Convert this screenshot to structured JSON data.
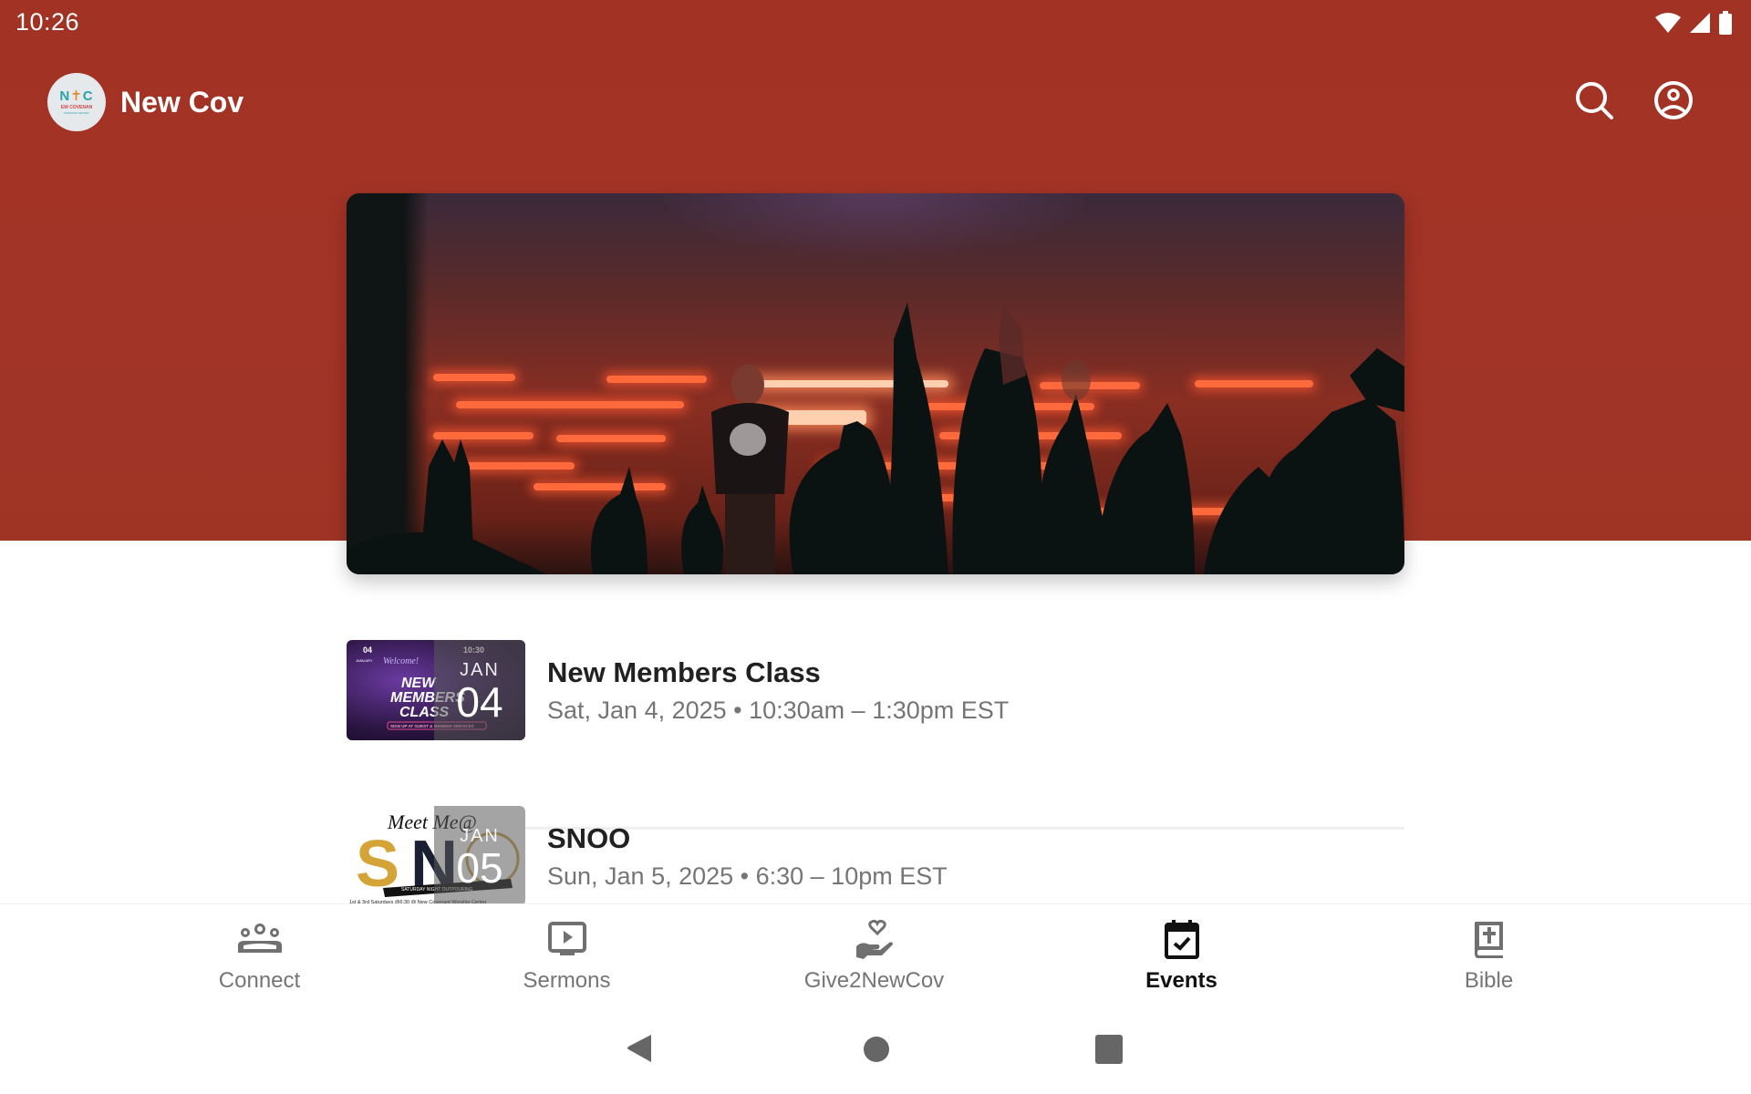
{
  "status_bar": {
    "time": "10:26",
    "icons": [
      "wifi-icon",
      "cellular-signal-icon",
      "battery-icon"
    ]
  },
  "app_bar": {
    "logo": {
      "mark": "NTC",
      "line1": "EW COVENAN",
      "line2": "WORSHIP CENTER"
    },
    "title": "New Cov",
    "actions": [
      "search-icon",
      "account-icon"
    ]
  },
  "hero": {
    "description": "Worship concert stage with red light bars and raised hands"
  },
  "events": [
    {
      "title": "New Members Class",
      "datetime": "Sat, Jan 4, 2025 • 10:30am – 1:30pm EST",
      "badge_month": "JAN",
      "badge_day": "04",
      "thumb_texts": [
        "04",
        "JANUARY",
        "Welcome!",
        "NEW MEMBERS CLASS",
        "10:30",
        "SIGN UP AT GUEST & MEMBER SERVICES"
      ]
    },
    {
      "title": "SNOO",
      "datetime": "Sun, Jan 5, 2025 • 6:30 – 10pm EST",
      "badge_month": "JAN",
      "badge_day": "05",
      "thumb_texts": [
        "Meet Me @",
        "SNO",
        "SATURDAY NIGHT OUTPOURING",
        "1st & 3rd Saturdays @6:30 @ New Covenant Worship Center"
      ]
    }
  ],
  "bottom_nav": {
    "items": [
      {
        "label": "Connect",
        "icon": "groups-icon",
        "active": false
      },
      {
        "label": "Sermons",
        "icon": "video-play-icon",
        "active": false
      },
      {
        "label": "Give2NewCov",
        "icon": "give-heart-hand-icon",
        "active": false
      },
      {
        "label": "Events",
        "icon": "calendar-check-icon",
        "active": true
      },
      {
        "label": "Bible",
        "icon": "bible-icon",
        "active": false
      }
    ]
  },
  "system_nav": [
    "back-icon",
    "home-icon",
    "recents-icon"
  ],
  "colors": {
    "brand_red": "#a13426",
    "active_nav": "#111111",
    "inactive_nav": "#757575",
    "title_text": "#212121",
    "subtitle_text": "#757575"
  }
}
